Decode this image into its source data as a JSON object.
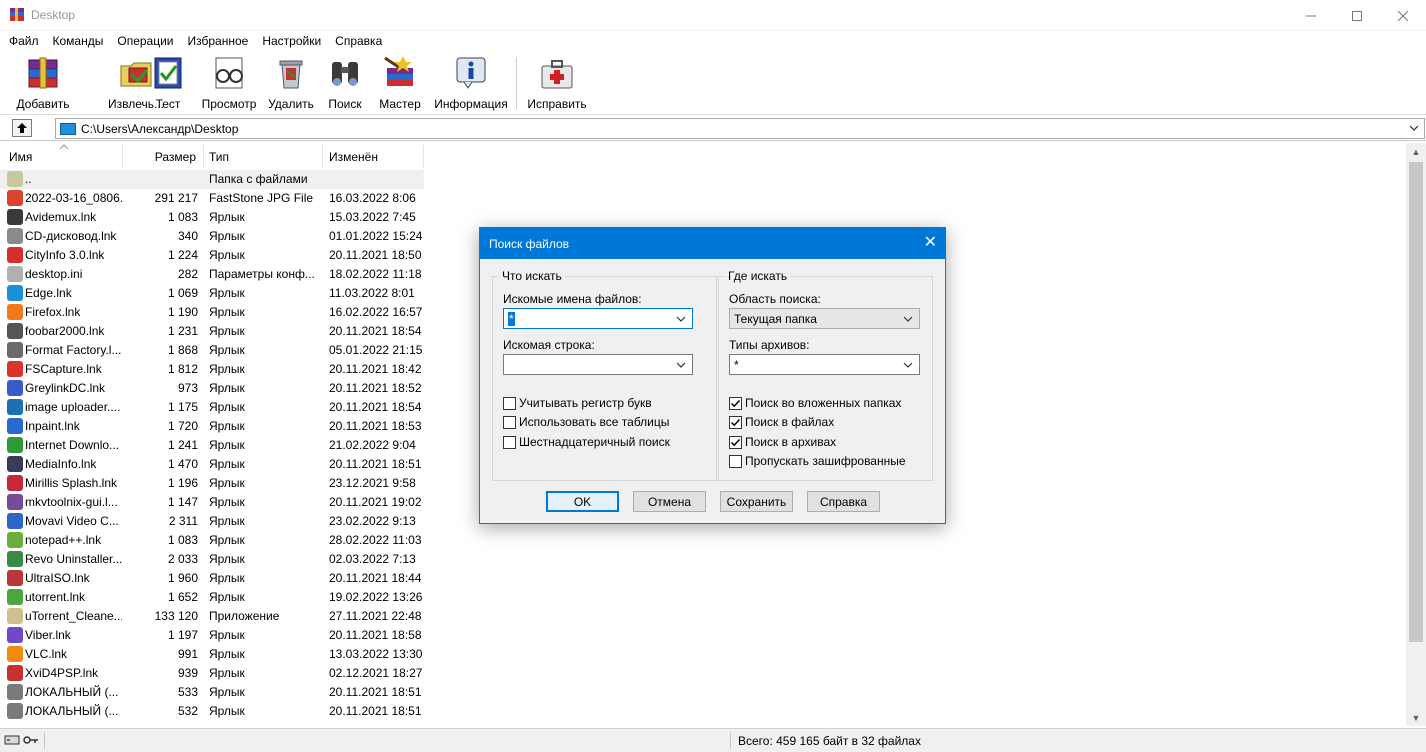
{
  "window": {
    "title": "Desktop",
    "controls": [
      "minimize",
      "maximize",
      "close"
    ]
  },
  "menu": [
    "Файл",
    "Команды",
    "Операции",
    "Избранное",
    "Настройки",
    "Справка"
  ],
  "toolbar": {
    "buttons": [
      {
        "label": "Добавить",
        "icon": "books-add-icon"
      },
      {
        "label": "Извлечь...",
        "icon": "extract-folder-icon"
      },
      {
        "label": "Тест",
        "icon": "test-check-icon"
      },
      {
        "label": "Просмотр",
        "icon": "glasses-view-icon"
      },
      {
        "label": "Удалить",
        "icon": "delete-recycle-icon"
      },
      {
        "label": "Поиск",
        "icon": "binoculars-search-icon"
      },
      {
        "label": "Мастер",
        "icon": "wizard-icon"
      },
      {
        "label": "Информация",
        "icon": "info-icon"
      },
      {
        "label": "Исправить",
        "icon": "first-aid-repair-icon"
      }
    ]
  },
  "address": {
    "path": "C:\\Users\\Александр\\Desktop"
  },
  "filelist": {
    "columns": [
      "Имя",
      "Размер",
      "Тип",
      "Изменён"
    ],
    "rows": [
      {
        "name": "..",
        "size": "",
        "type": "Папка с файлами",
        "modified": "",
        "color": "#c8c89c"
      },
      {
        "name": "2022-03-16_0806...",
        "size": "291 217",
        "type": "FastStone JPG File",
        "modified": "16.03.2022 8:06",
        "color": "#d9452b"
      },
      {
        "name": "Avidemux.lnk",
        "size": "1 083",
        "type": "Ярлык",
        "modified": "15.03.2022 7:45",
        "color": "#3a3a3a"
      },
      {
        "name": "CD-дисковод.lnk",
        "size": "340",
        "type": "Ярлык",
        "modified": "01.01.2022 15:24",
        "color": "#8a8a8a"
      },
      {
        "name": "CityInfo 3.0.lnk",
        "size": "1 224",
        "type": "Ярлык",
        "modified": "20.11.2021 18:50",
        "color": "#d23030"
      },
      {
        "name": "desktop.ini",
        "size": "282",
        "type": "Параметры конф...",
        "modified": "18.02.2022 11:18",
        "color": "#b0b0b0"
      },
      {
        "name": "Edge.lnk",
        "size": "1 069",
        "type": "Ярлык",
        "modified": "11.03.2022 8:01",
        "color": "#1b8fd8"
      },
      {
        "name": "Firefox.lnk",
        "size": "1 190",
        "type": "Ярлык",
        "modified": "16.02.2022 16:57",
        "color": "#f07a1c"
      },
      {
        "name": "foobar2000.lnk",
        "size": "1 231",
        "type": "Ярлык",
        "modified": "20.11.2021 18:54",
        "color": "#555555"
      },
      {
        "name": "Format Factory.l...",
        "size": "1 868",
        "type": "Ярлык",
        "modified": "05.01.2022 21:15",
        "color": "#6b6b6b"
      },
      {
        "name": "FSCapture.lnk",
        "size": "1 812",
        "type": "Ярлык",
        "modified": "20.11.2021 18:42",
        "color": "#d8362c"
      },
      {
        "name": "GreylinkDC.lnk",
        "size": "973",
        "type": "Ярлык",
        "modified": "20.11.2021 18:52",
        "color": "#3a5cc9"
      },
      {
        "name": "image uploader....",
        "size": "1 175",
        "type": "Ярлык",
        "modified": "20.11.2021 18:54",
        "color": "#1f6fb7"
      },
      {
        "name": "Inpaint.lnk",
        "size": "1 720",
        "type": "Ярлык",
        "modified": "20.11.2021 18:53",
        "color": "#2a6ad0"
      },
      {
        "name": "Internet Downlo...",
        "size": "1 241",
        "type": "Ярлык",
        "modified": "21.02.2022 9:04",
        "color": "#2f9a3a"
      },
      {
        "name": "MediaInfo.lnk",
        "size": "1 470",
        "type": "Ярлык",
        "modified": "20.11.2021 18:51",
        "color": "#3a3a5a"
      },
      {
        "name": "Mirillis Splash.lnk",
        "size": "1 196",
        "type": "Ярлык",
        "modified": "23.12.2021 9:58",
        "color": "#c8283c"
      },
      {
        "name": "mkvtoolnix-gui.l...",
        "size": "1 147",
        "type": "Ярлык",
        "modified": "20.11.2021 19:02",
        "color": "#7a4a9a"
      },
      {
        "name": "Movavi Video C...",
        "size": "2 311",
        "type": "Ярлык",
        "modified": "23.02.2022 9:13",
        "color": "#2f64c8"
      },
      {
        "name": "notepad++.lnk",
        "size": "1 083",
        "type": "Ярлык",
        "modified": "28.02.2022 11:03",
        "color": "#6cae3a"
      },
      {
        "name": "Revo Uninstaller....",
        "size": "2 033",
        "type": "Ярлык",
        "modified": "02.03.2022 7:13",
        "color": "#3a8a4a"
      },
      {
        "name": "UltraISO.lnk",
        "size": "1 960",
        "type": "Ярлык",
        "modified": "20.11.2021 18:44",
        "color": "#b8383a"
      },
      {
        "name": "utorrent.lnk",
        "size": "1 652",
        "type": "Ярлык",
        "modified": "19.02.2022 13:26",
        "color": "#4aa83a"
      },
      {
        "name": "uTorrent_Cleane...",
        "size": "133 120",
        "type": "Приложение",
        "modified": "27.11.2021 22:48",
        "color": "#d0c090"
      },
      {
        "name": "Viber.lnk",
        "size": "1 197",
        "type": "Ярлык",
        "modified": "20.11.2021 18:58",
        "color": "#7048c8"
      },
      {
        "name": "VLC.lnk",
        "size": "991",
        "type": "Ярлык",
        "modified": "13.03.2022 13:30",
        "color": "#f08a10"
      },
      {
        "name": "XviD4PSP.lnk",
        "size": "939",
        "type": "Ярлык",
        "modified": "02.12.2021 18:27",
        "color": "#c83030"
      },
      {
        "name": "ЛОКАЛЬНЫЙ  (...",
        "size": "533",
        "type": "Ярлык",
        "modified": "20.11.2021 18:51",
        "color": "#7a7a7a"
      },
      {
        "name": "ЛОКАЛЬНЫЙ  (...",
        "size": "532",
        "type": "Ярлык",
        "modified": "20.11.2021 18:51",
        "color": "#7a7a7a"
      }
    ]
  },
  "status": {
    "text": "Всего: 459 165 байт в 32 файлах"
  },
  "dialog": {
    "title": "Поиск файлов",
    "what_group": "Что искать",
    "filenames_label": "Искомые имена файлов:",
    "filenames_value": "*",
    "string_label": "Искомая строка:",
    "string_value": "",
    "case_label": "Учитывать регистр букв",
    "case_checked": false,
    "alltables_label": "Использовать все таблицы",
    "alltables_checked": false,
    "hex_label": "Шестнадцатеричный поиск",
    "hex_checked": false,
    "where_group": "Где искать",
    "area_label": "Область поиска:",
    "area_value": "Текущая папка",
    "archtypes_label": "Типы архивов:",
    "archtypes_value": "*",
    "subfolders_label": "Поиск во вложенных папках",
    "subfolders_checked": true,
    "infiles_label": "Поиск в файлах",
    "infiles_checked": true,
    "inarchives_label": "Поиск в архивах",
    "inarchives_checked": true,
    "skipenc_label": "Пропускать зашифрованные",
    "skipenc_checked": false,
    "ok_label": "OK",
    "cancel_label": "Отмена",
    "save_label": "Сохранить",
    "help_label": "Справка"
  }
}
